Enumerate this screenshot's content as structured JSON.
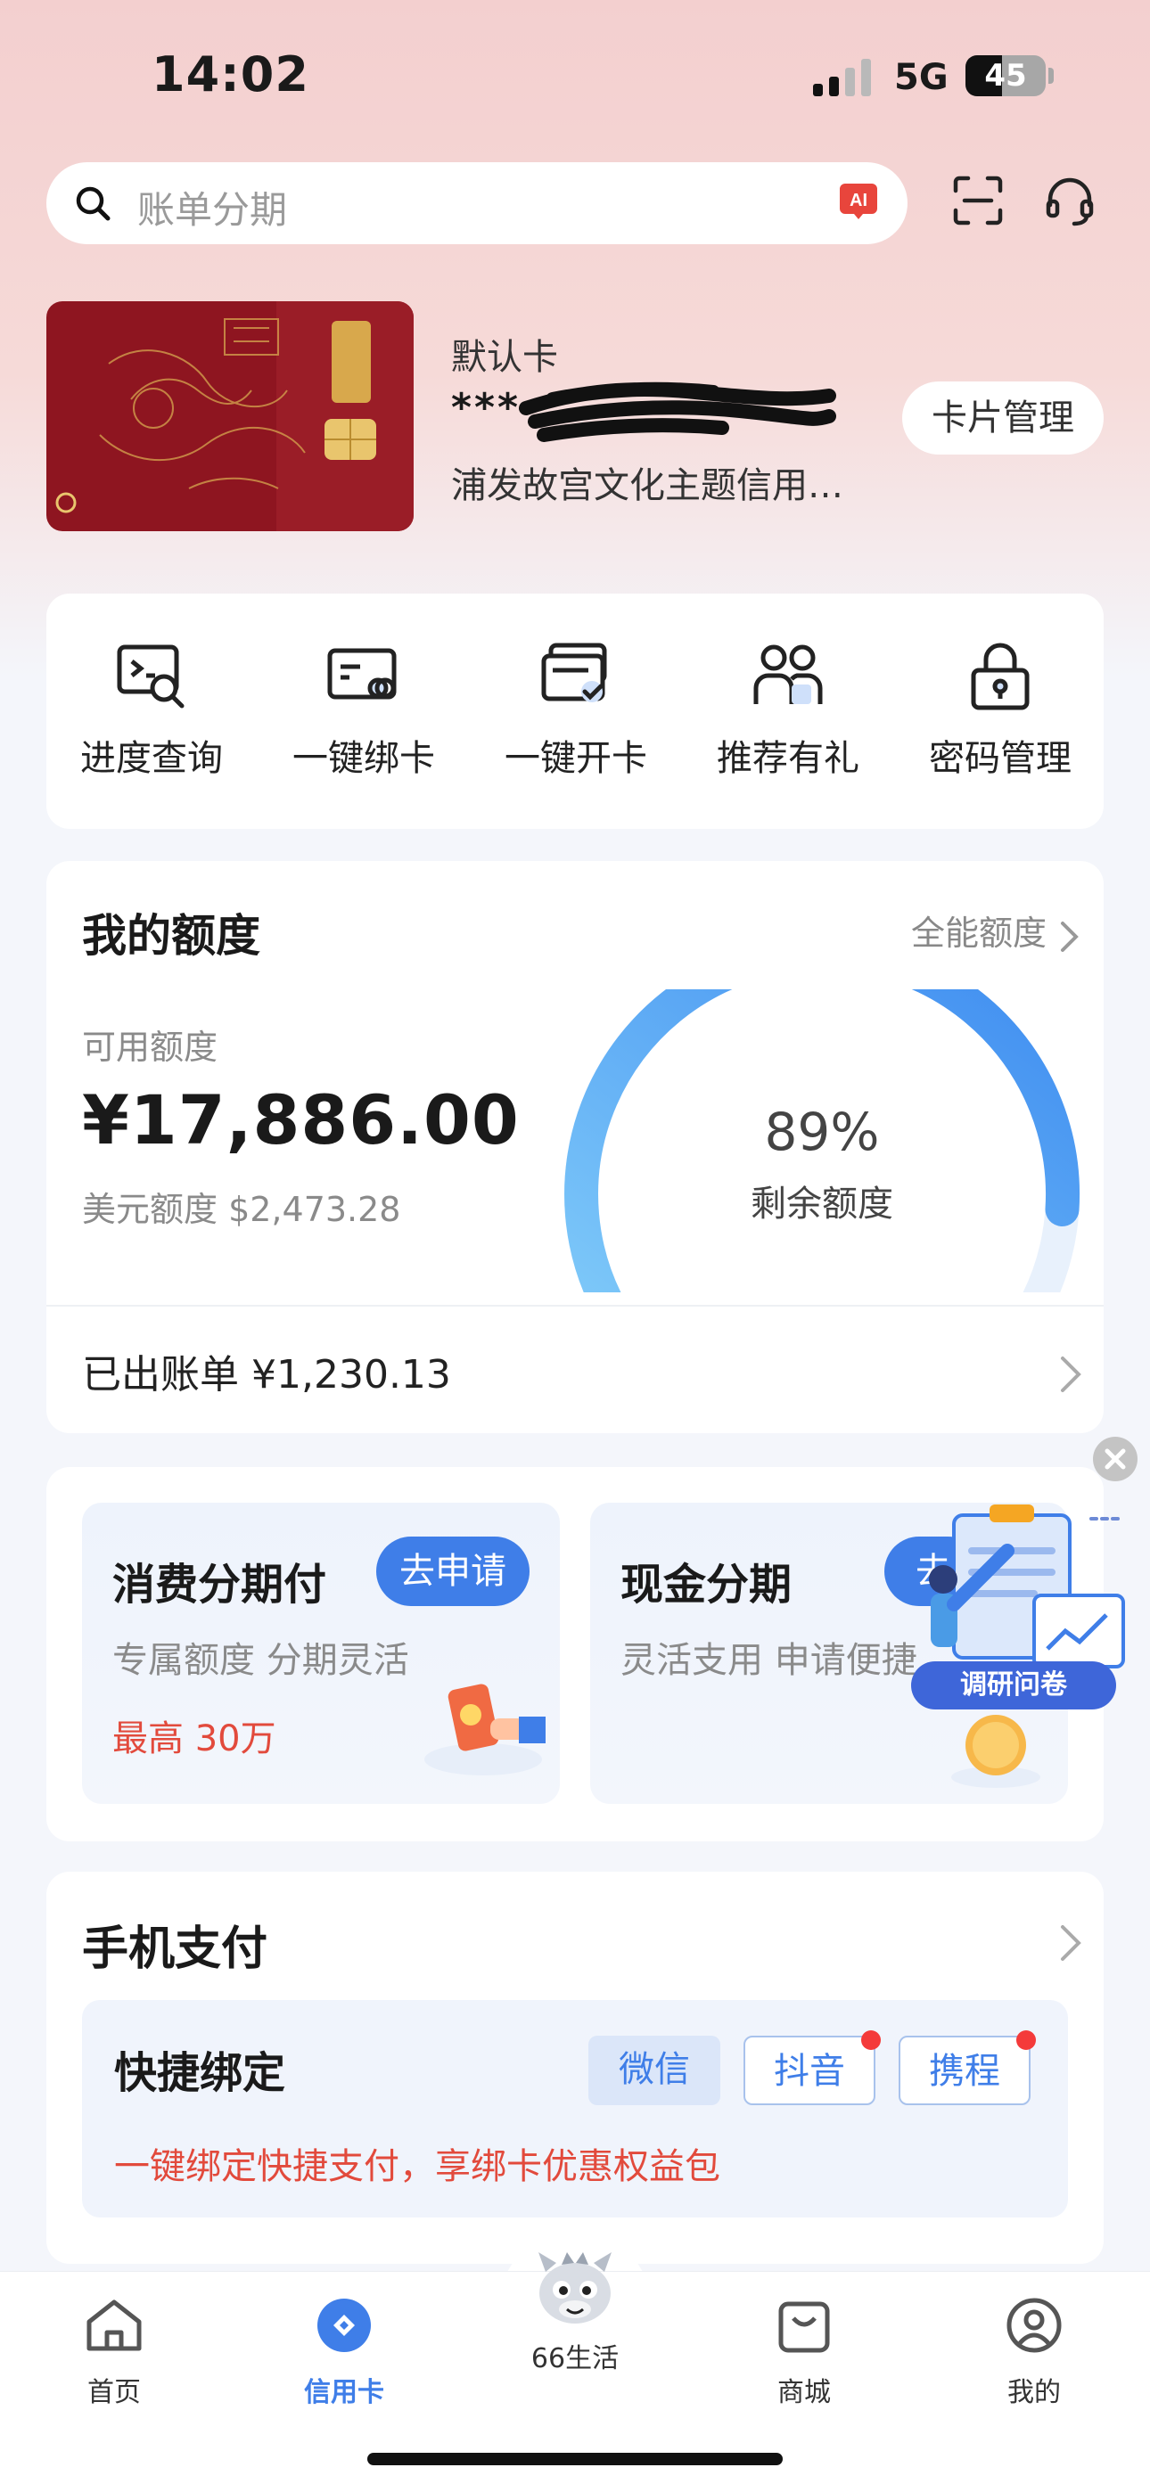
{
  "status_bar": {
    "time": "14:02",
    "network": "5G",
    "battery": "45",
    "battery_level": 0.45
  },
  "search": {
    "placeholder": "账单分期",
    "ai_badge": "AI"
  },
  "default_card": {
    "label": "默认卡",
    "number": "***",
    "name": "浦发故宫文化主题信用…",
    "manage_button": "卡片管理"
  },
  "quick_actions": [
    {
      "label": "进度查询",
      "icon": "progress-search-icon"
    },
    {
      "label": "一键绑卡",
      "icon": "bind-card-icon"
    },
    {
      "label": "一键开卡",
      "icon": "activate-card-icon"
    },
    {
      "label": "推荐有礼",
      "icon": "referral-icon"
    },
    {
      "label": "密码管理",
      "icon": "lock-icon"
    }
  ],
  "credit_limit": {
    "title": "我的额度",
    "link": "全能额度",
    "available_label": "可用额度",
    "available_amount": "¥17,886.00",
    "usd_limit": "美元额度 $2,473.28",
    "remaining_percent_text": "89%",
    "remaining_fraction": 0.89,
    "remaining_label": "剩余额度",
    "statement": "已出账单 ¥1,230.13"
  },
  "promotions": [
    {
      "title": "消费分期付",
      "button": "去申请",
      "subtitle": "专属额度 分期灵活",
      "highlight": "最高 30万"
    },
    {
      "title": "现金分期",
      "button": "去",
      "subtitle": "灵活支用 申请便捷"
    }
  ],
  "survey": {
    "label": "调研问卷"
  },
  "mobile_pay": {
    "title": "手机支付",
    "bind_title": "快捷绑定",
    "options": [
      {
        "label": "微信",
        "has_dot": false
      },
      {
        "label": "抖音",
        "has_dot": true
      },
      {
        "label": "携程",
        "has_dot": true
      }
    ],
    "note": "一键绑定快捷支付，享绑卡优惠权益包"
  },
  "tab_bar": [
    {
      "label": "首页",
      "icon": "home-icon",
      "active": false
    },
    {
      "label": "信用卡",
      "icon": "credit-card-tab-icon",
      "active": true
    },
    {
      "label": "66生活",
      "icon": "dragon-mascot-icon",
      "active": false
    },
    {
      "label": "商城",
      "icon": "shopping-bag-icon",
      "active": false
    },
    {
      "label": "我的",
      "icon": "profile-icon",
      "active": false
    }
  ],
  "colors": {
    "accent": "#3f7ee8",
    "alert": "#e24a3c",
    "header_bg": "#f3cfcf",
    "gauge": "#4ca3f3"
  }
}
